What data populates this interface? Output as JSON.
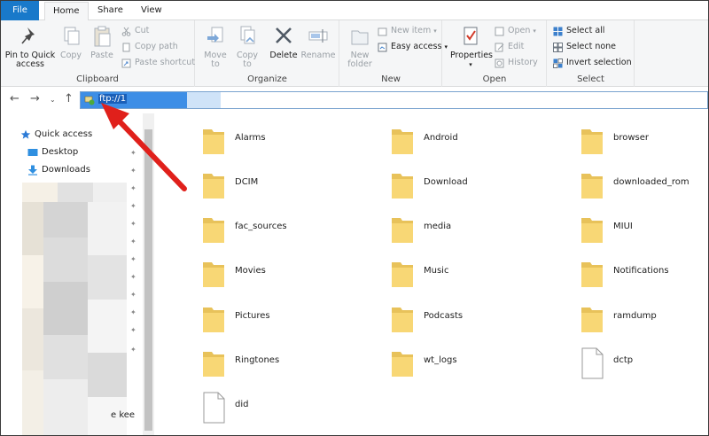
{
  "tabs": [
    {
      "label": "File"
    },
    {
      "label": "Home"
    },
    {
      "label": "Share"
    },
    {
      "label": "View"
    }
  ],
  "ribbon": {
    "clipboard": {
      "label": "Clipboard",
      "pin_label_1": "Pin to Quick",
      "pin_label_2": "access",
      "copy": "Copy",
      "paste": "Paste",
      "cut": "Cut",
      "copy_path": "Copy path",
      "paste_shortcut": "Paste shortcut"
    },
    "organize": {
      "label": "Organize",
      "move_1": "Move",
      "move_2": "to",
      "copy_1": "Copy",
      "copy_2": "to",
      "delete": "Delete",
      "rename": "Rename"
    },
    "new": {
      "label": "New",
      "new_folder_1": "New",
      "new_folder_2": "folder",
      "new_item": "New item",
      "easy_access": "Easy access"
    },
    "open": {
      "label": "Open",
      "properties": "Properties",
      "open": "Open",
      "edit": "Edit",
      "history": "History"
    },
    "select": {
      "label": "Select",
      "select_all": "Select all",
      "select_none": "Select none",
      "invert": "Invert selection"
    }
  },
  "address": {
    "value": "ftp://1"
  },
  "nav": {
    "quick_access": "Quick access",
    "desktop": "Desktop",
    "downloads": "Downloads",
    "tail_text": "e kee"
  },
  "items": [
    {
      "name": "Alarms",
      "type": "folder"
    },
    {
      "name": "Android",
      "type": "folder"
    },
    {
      "name": "browser",
      "type": "folder"
    },
    {
      "name": "DCIM",
      "type": "folder"
    },
    {
      "name": "Download",
      "type": "folder"
    },
    {
      "name": "downloaded_rom",
      "type": "folder"
    },
    {
      "name": "fac_sources",
      "type": "folder"
    },
    {
      "name": "media",
      "type": "folder"
    },
    {
      "name": "MIUI",
      "type": "folder"
    },
    {
      "name": "Movies",
      "type": "folder"
    },
    {
      "name": "Music",
      "type": "folder"
    },
    {
      "name": "Notifications",
      "type": "folder"
    },
    {
      "name": "Pictures",
      "type": "folder"
    },
    {
      "name": "Podcasts",
      "type": "folder"
    },
    {
      "name": "ramdump",
      "type": "folder"
    },
    {
      "name": "Ringtones",
      "type": "folder"
    },
    {
      "name": "wt_logs",
      "type": "folder"
    },
    {
      "name": "dctp",
      "type": "file"
    },
    {
      "name": "did",
      "type": "file"
    }
  ],
  "colors": {
    "accent": "#1979ca",
    "folder": "#f8d775",
    "annotation_arrow": "#e0201b"
  }
}
